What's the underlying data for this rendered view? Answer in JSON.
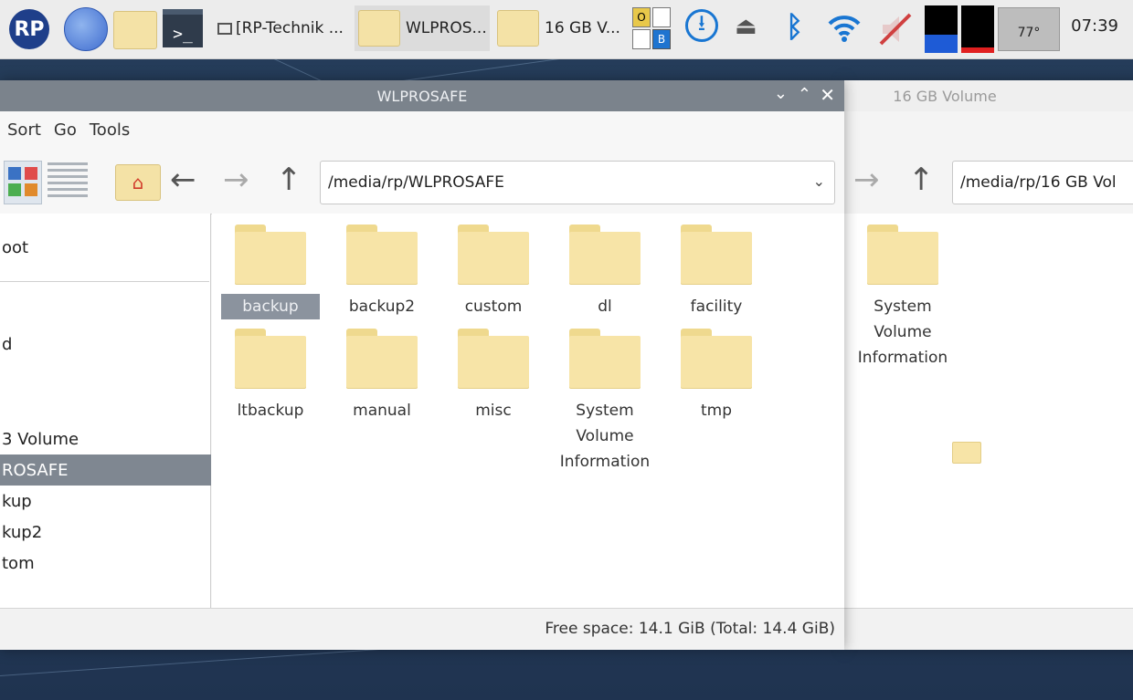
{
  "taskbar": {
    "tasks": [
      {
        "label": "[RP-Technik ..."
      },
      {
        "label": "WLPROS..."
      },
      {
        "label": "16 GB V..."
      }
    ],
    "indicators": {
      "keyboard_o": "O",
      "keyboard_b": "B"
    },
    "temperature": "77°",
    "clock": "07:39"
  },
  "main_window": {
    "title": "WLPROSAFE",
    "menu": [
      "Sort",
      "Go",
      "Tools"
    ],
    "path": "/media/rp/WLPROSAFE",
    "sidebar": [
      "oot",
      "d",
      "3 Volume",
      "ROSAFE",
      "kup",
      "kup2",
      "tom"
    ],
    "selected_sidebar": "ROSAFE",
    "files": [
      "backup",
      "backup2",
      "custom",
      "dl",
      "facility",
      "ltbackup",
      "manual",
      "misc",
      "System\nVolume\nInformation",
      "tmp"
    ],
    "selected_file": "backup",
    "status": "Free space: 14.1 GiB (Total: 14.4 GiB)"
  },
  "back_window": {
    "title": "16 GB Volume",
    "path": "/media/rp/16 GB Vol",
    "files": [
      "System\nVolume\nInformation"
    ]
  },
  "colors": {
    "accent_blue": "#1976d2",
    "folder": "#f7e4a7",
    "selection": "#7f8791",
    "titlebar": "#7b838c"
  }
}
